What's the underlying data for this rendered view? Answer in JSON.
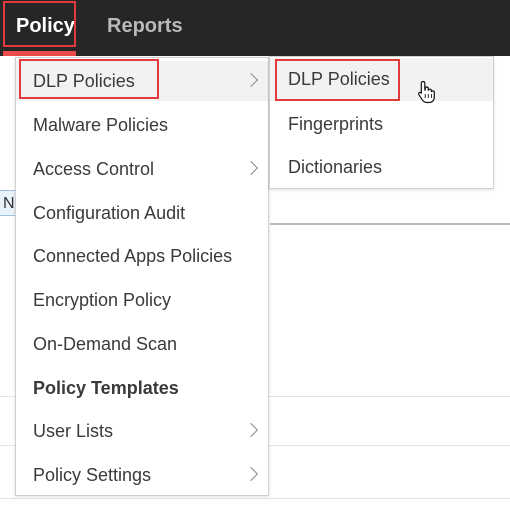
{
  "topbar": {
    "policy_label": "Policy",
    "reports_label": "Reports"
  },
  "background": {
    "chip_text": "N"
  },
  "menu": {
    "items": [
      {
        "label": "DLP Policies",
        "has_submenu": true,
        "highlighted": true
      },
      {
        "label": "Malware Policies",
        "has_submenu": false
      },
      {
        "label": "Access Control",
        "has_submenu": true
      },
      {
        "label": "Configuration Audit",
        "has_submenu": false
      },
      {
        "label": "Connected Apps Policies",
        "has_submenu": false
      },
      {
        "label": "Encryption Policy",
        "has_submenu": false
      },
      {
        "label": "On-Demand Scan",
        "has_submenu": false
      },
      {
        "label": "Policy Templates",
        "has_submenu": false,
        "bold": true
      },
      {
        "label": "User Lists",
        "has_submenu": true
      },
      {
        "label": "Policy Settings",
        "has_submenu": true
      }
    ]
  },
  "submenu": {
    "items": [
      {
        "label": "DLP Policies",
        "highlighted": true
      },
      {
        "label": "Fingerprints"
      },
      {
        "label": "Dictionaries"
      }
    ]
  },
  "colors": {
    "topbar_bg": "#262626",
    "highlight_red": "#e03a3a",
    "hover_bg": "#f2f2f2",
    "text": "#3a3a3a"
  },
  "icons": [
    "chevron-right-icon",
    "hand-pointer-cursor-icon"
  ]
}
